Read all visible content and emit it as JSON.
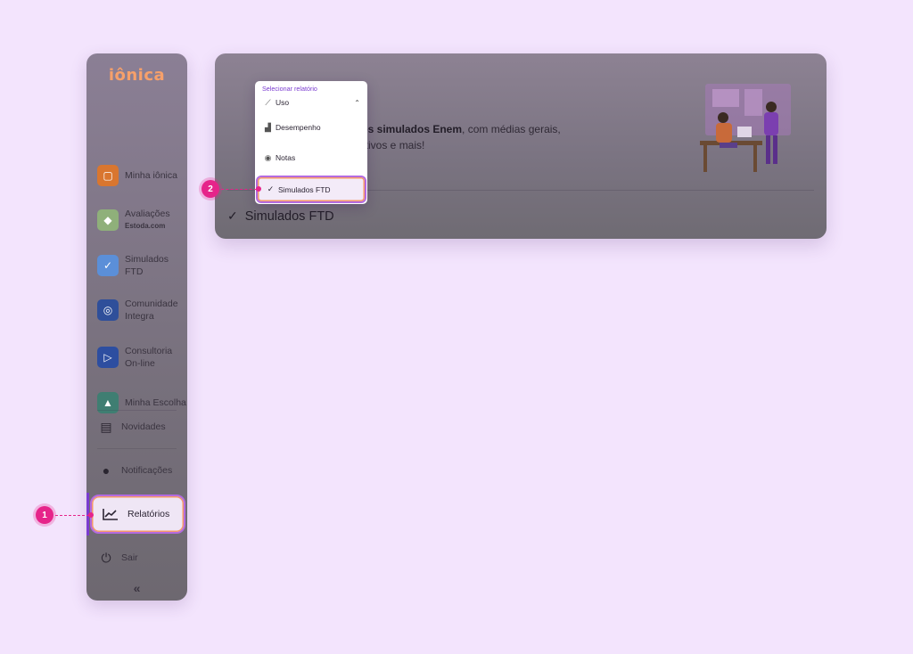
{
  "sidebar": {
    "logo": "iônica",
    "items": [
      {
        "label": "Minha iônica",
        "icon": "backpack-icon",
        "color": "#d9762f"
      },
      {
        "label": "Avaliações",
        "sub": "Estoda.com",
        "icon": "assessment-icon",
        "color": "#8fb07a"
      },
      {
        "label": "Simulados FTD",
        "icon": "check-badge-icon",
        "color": "#5b8fd8"
      },
      {
        "label": "Comunidade Integra",
        "icon": "community-icon",
        "color": "#2f4f9a"
      },
      {
        "label": "Consultoria On-line",
        "icon": "video-chat-icon",
        "color": "#2d4ea0"
      },
      {
        "label": "Minha Escolha",
        "icon": "graduation-icon",
        "color": "#3f7e72"
      }
    ],
    "bottom_items": [
      {
        "label": "Novidades",
        "icon": "newspaper-icon"
      },
      {
        "label": "Notificações",
        "icon": "bell-icon"
      },
      {
        "label": "Relatórios",
        "icon": "chart-icon"
      },
      {
        "label": "Sair",
        "icon": "power-icon"
      }
    ],
    "collapse": "«"
  },
  "card": {
    "text_bold": "dos simulados Enem",
    "text_rest": ", com médias gerais,",
    "text_line2": "ativos e mais!",
    "title": "Simulados FTD"
  },
  "dropdown": {
    "label": "Selecionar relatório",
    "selected": "Uso",
    "options": [
      "Desempenho",
      "Notas",
      "Simulados FTD"
    ]
  },
  "callouts": [
    "1",
    "2"
  ],
  "colors": {
    "accent": "#b46be0",
    "callout": "#e6248a",
    "background": "#f3e4fd"
  }
}
